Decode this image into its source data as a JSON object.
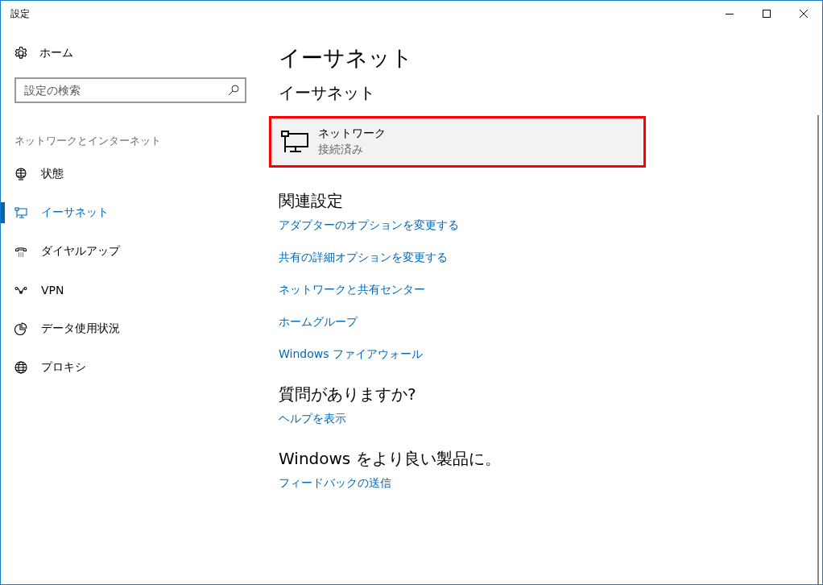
{
  "window": {
    "title": "設定"
  },
  "sidebar": {
    "home": "ホーム",
    "search": {
      "placeholder": "設定の検索"
    },
    "category": "ネットワークとインターネット",
    "items": [
      {
        "kind": "status",
        "label": "状態",
        "selected": false
      },
      {
        "kind": "ethernet",
        "label": "イーサネット",
        "selected": true
      },
      {
        "kind": "dialup",
        "label": "ダイヤルアップ",
        "selected": false
      },
      {
        "kind": "vpn",
        "label": "VPN",
        "selected": false
      },
      {
        "kind": "data-usage",
        "label": "データ使用状況",
        "selected": false
      },
      {
        "kind": "proxy",
        "label": "プロキシ",
        "selected": false
      }
    ]
  },
  "main": {
    "title": "イーサネット",
    "subtitle": "イーサネット",
    "network": {
      "name": "ネットワーク",
      "status": "接続済み",
      "highlighted": true
    },
    "sections": [
      {
        "heading": "関連設定",
        "links": [
          "アダプターのオプションを変更する",
          "共有の詳細オプションを変更する",
          "ネットワークと共有センター",
          "ホームグループ",
          "Windows ファイアウォール"
        ]
      },
      {
        "heading": "質問がありますか?",
        "links": [
          "ヘルプを表示"
        ]
      },
      {
        "heading": "Windows をより良い製品に。",
        "links": [
          "フィードバックの送信"
        ]
      }
    ]
  }
}
